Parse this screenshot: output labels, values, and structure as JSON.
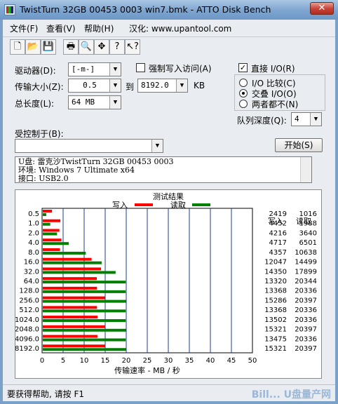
{
  "window": {
    "title": "TwistTurn 32GB 00453 0003 win7.bmk - ATTO Disk Bench",
    "close": "✕"
  },
  "menu": [
    "文件(F)",
    "查看(V)",
    "帮助(H)",
    "汉化: www.upantool.com"
  ],
  "toolbar": [
    "new-document",
    "open-folder",
    "save",
    "print",
    "print-preview",
    "move",
    "help",
    "context-help"
  ],
  "form": {
    "drive_label": "驱动器(D):",
    "drive_value": "[-m-]",
    "force_write_label": "强制写入访问(A)",
    "transfer_label": "传输大小(Z):",
    "transfer_from": "0.5",
    "transfer_to_label": "到",
    "transfer_to": "8192.0",
    "transfer_unit": "KB",
    "total_label": "总长度(L):",
    "total_value": "64 MB",
    "direct_io_label": "直接 I/O(R)",
    "io_compare_label": "I/O 比较(C)",
    "overlap_io_label": "交叠 I/O(O)",
    "neither_label": "两者都不(N)",
    "queue_label": "队列深度(Q):",
    "queue_value": "4",
    "controlled_label": "受控制于(B):",
    "controlled_value": "",
    "start_label": "开始(S)"
  },
  "info_lines": [
    "U盘: 雷克沙TwistTurn 32GB 00453 0003",
    "环境: Windows 7 Ultimate x64",
    "接口: USB2.0"
  ],
  "status_text": "要获得帮助, 请按 F1",
  "watermark": "Bill... U盘量产网",
  "chart_data": {
    "type": "bar",
    "title": "测试结果",
    "legend": [
      {
        "name": "写入",
        "color": "#ff0000"
      },
      {
        "name": "读取",
        "color": "#008000"
      }
    ],
    "categories": [
      "0.5",
      "1.0",
      "2.0",
      "4.0",
      "8.0",
      "16.0",
      "32.0",
      "64.0",
      "128.0",
      "256.0",
      "512.0",
      "1024.0",
      "2048.0",
      "4096.0",
      "8192.0"
    ],
    "series": [
      {
        "name": "写入",
        "values": [
          2419,
          4452,
          4216,
          4717,
          4357,
          12047,
          14350,
          13320,
          13368,
          15286,
          13368,
          13502,
          15321,
          13475,
          15321
        ]
      },
      {
        "name": "读取",
        "values": [
          1016,
          1988,
          3640,
          6501,
          10638,
          14499,
          17899,
          20344,
          20336,
          20397,
          20336,
          20336,
          20397,
          20336,
          20397
        ]
      }
    ],
    "col_headers": [
      "写入",
      "读取"
    ],
    "xlabel": "传输速率 - MB / 秒",
    "xticks": [
      "0",
      "5",
      "10",
      "15",
      "20",
      "25",
      "30",
      "35",
      "40",
      "45",
      "50"
    ],
    "xlim": [
      0,
      50
    ],
    "units": "KB/s"
  }
}
